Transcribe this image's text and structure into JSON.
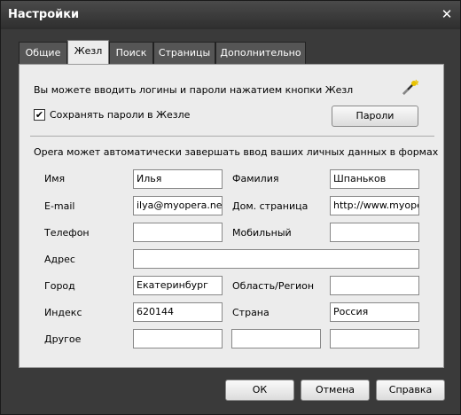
{
  "window": {
    "title": "Настройки"
  },
  "tabs": [
    "Общие",
    "Жезл",
    "Поиск",
    "Страницы",
    "Дополнительно"
  ],
  "panel": {
    "info_text": "Вы можете вводить логины и пароли нажатием кнопки Жезл",
    "save_passwords_label": "Сохранять пароли в Жезле",
    "save_passwords_checked": true,
    "passwords_button": "Пароли",
    "autofill_text": "Opera может автоматически завершать ввод ваших личных данных в формах"
  },
  "form": {
    "first_name": {
      "label": "Имя",
      "value": "Илья"
    },
    "last_name": {
      "label": "Фамилия",
      "value": "Шпаньков"
    },
    "email": {
      "label": "E-mail",
      "value": "ilya@myopera.net"
    },
    "homepage": {
      "label": "Дом. страница",
      "value": "http://www.myoper"
    },
    "phone": {
      "label": "Телефон",
      "value": ""
    },
    "mobile": {
      "label": "Мобильный",
      "value": ""
    },
    "address": {
      "label": "Адрес",
      "value": ""
    },
    "city": {
      "label": "Город",
      "value": "Екатеринбург"
    },
    "region": {
      "label": "Область/Регион",
      "value": ""
    },
    "zip": {
      "label": "Индекс",
      "value": "620144"
    },
    "country": {
      "label": "Страна",
      "value": "Россия"
    },
    "other": {
      "label": "Другое",
      "values": [
        "",
        "",
        ""
      ]
    }
  },
  "footer": {
    "ok": "ОК",
    "cancel": "Отмена",
    "help": "Справка"
  }
}
